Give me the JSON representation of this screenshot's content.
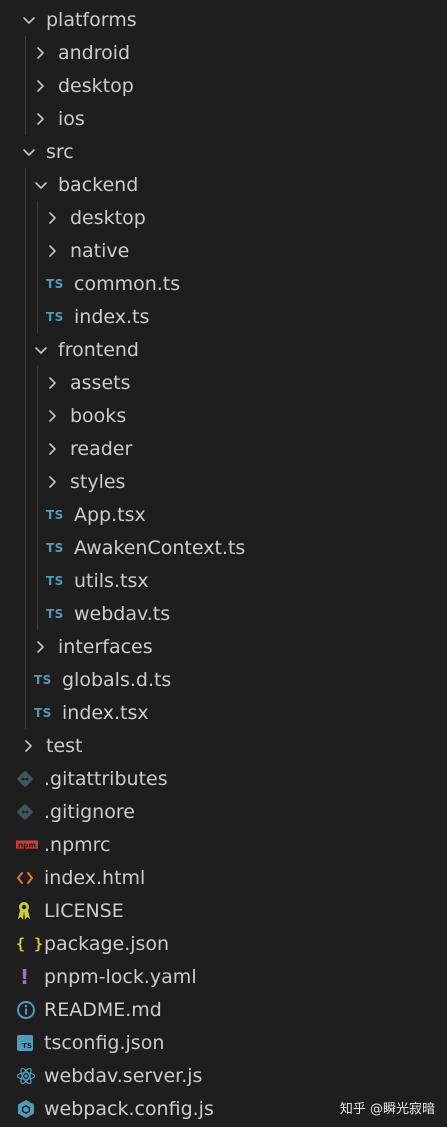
{
  "explorer": {
    "items": [
      {
        "label": "platforms",
        "kind": "folder",
        "open": true,
        "depth": 0
      },
      {
        "label": "android",
        "kind": "folder",
        "open": false,
        "depth": 1
      },
      {
        "label": "desktop",
        "kind": "folder",
        "open": false,
        "depth": 1
      },
      {
        "label": "ios",
        "kind": "folder",
        "open": false,
        "depth": 1
      },
      {
        "label": "src",
        "kind": "folder",
        "open": true,
        "depth": 0
      },
      {
        "label": "backend",
        "kind": "folder",
        "open": true,
        "depth": 1
      },
      {
        "label": "desktop",
        "kind": "folder",
        "open": false,
        "depth": 2
      },
      {
        "label": "native",
        "kind": "folder",
        "open": false,
        "depth": 2
      },
      {
        "label": "common.ts",
        "kind": "file",
        "icon": "typescript-icon",
        "depth": 2
      },
      {
        "label": "index.ts",
        "kind": "file",
        "icon": "typescript-icon",
        "depth": 2
      },
      {
        "label": "frontend",
        "kind": "folder",
        "open": true,
        "depth": 1
      },
      {
        "label": "assets",
        "kind": "folder",
        "open": false,
        "depth": 2
      },
      {
        "label": "books",
        "kind": "folder",
        "open": false,
        "depth": 2
      },
      {
        "label": "reader",
        "kind": "folder",
        "open": false,
        "depth": 2
      },
      {
        "label": "styles",
        "kind": "folder",
        "open": false,
        "depth": 2
      },
      {
        "label": "App.tsx",
        "kind": "file",
        "icon": "typescript-icon",
        "depth": 2
      },
      {
        "label": "AwakenContext.ts",
        "kind": "file",
        "icon": "typescript-icon",
        "depth": 2
      },
      {
        "label": "utils.tsx",
        "kind": "file",
        "icon": "typescript-icon",
        "depth": 2
      },
      {
        "label": "webdav.ts",
        "kind": "file",
        "icon": "typescript-icon",
        "depth": 2
      },
      {
        "label": "interfaces",
        "kind": "folder",
        "open": false,
        "depth": 1
      },
      {
        "label": "globals.d.ts",
        "kind": "file",
        "icon": "typescript-icon",
        "depth": 1
      },
      {
        "label": "index.tsx",
        "kind": "file",
        "icon": "typescript-icon",
        "depth": 1
      },
      {
        "label": "test",
        "kind": "folder",
        "open": false,
        "depth": 0
      },
      {
        "label": ".gitattributes",
        "kind": "file",
        "icon": "git-icon",
        "depth": 0
      },
      {
        "label": ".gitignore",
        "kind": "file",
        "icon": "git-icon",
        "depth": 0
      },
      {
        "label": ".npmrc",
        "kind": "file",
        "icon": "npm-icon",
        "depth": 0
      },
      {
        "label": "index.html",
        "kind": "file",
        "icon": "html-icon",
        "depth": 0
      },
      {
        "label": "LICENSE",
        "kind": "file",
        "icon": "license-icon",
        "depth": 0
      },
      {
        "label": "package.json",
        "kind": "file",
        "icon": "json-icon",
        "depth": 0
      },
      {
        "label": "pnpm-lock.yaml",
        "kind": "file",
        "icon": "yaml-icon",
        "depth": 0
      },
      {
        "label": "README.md",
        "kind": "file",
        "icon": "info-icon",
        "depth": 0
      },
      {
        "label": "tsconfig.json",
        "kind": "file",
        "icon": "tsconfig-icon",
        "depth": 0
      },
      {
        "label": "webdav.server.js",
        "kind": "file",
        "icon": "react-icon",
        "depth": 0
      },
      {
        "label": "webpack.config.js",
        "kind": "file",
        "icon": "webpack-icon",
        "depth": 0
      }
    ]
  },
  "colors": {
    "background": "#1e1e1e",
    "text": "#cccccc",
    "guide": "#3a3a3a",
    "typescript": "#519aba",
    "git": "#41535b",
    "npm": "#cb3837",
    "html": "#e37933",
    "license": "#cbcb41",
    "json": "#cbcb41",
    "yaml": "#a074c4",
    "info": "#519aba",
    "react": "#519aba"
  },
  "icon_text": {
    "typescript": "TS",
    "npm": "npm",
    "json": "{ }",
    "yaml": "!"
  },
  "watermark": "知乎 @瞬光寂暗"
}
